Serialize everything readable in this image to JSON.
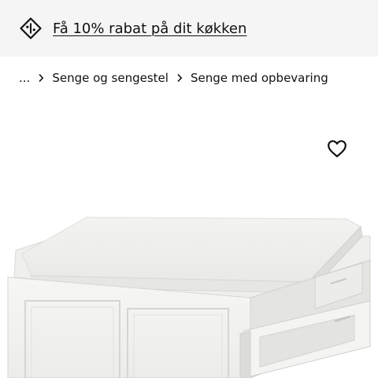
{
  "promo": {
    "icon": "discount-tag-icon",
    "text": "Få 10% rabat på dit køkken"
  },
  "breadcrumb": {
    "ellipsis": "...",
    "separator_icon": "chevron-right-icon",
    "items": [
      {
        "label": "Senge og sengestel"
      },
      {
        "label": "Senge med opbevaring"
      }
    ]
  },
  "product": {
    "favourite_icon": "heart-outline-icon",
    "image_subject": "white-bed-frame-with-drawers"
  },
  "colors": {
    "banner_bg": "#f5f5f5",
    "text": "#111111",
    "background": "#ffffff"
  }
}
